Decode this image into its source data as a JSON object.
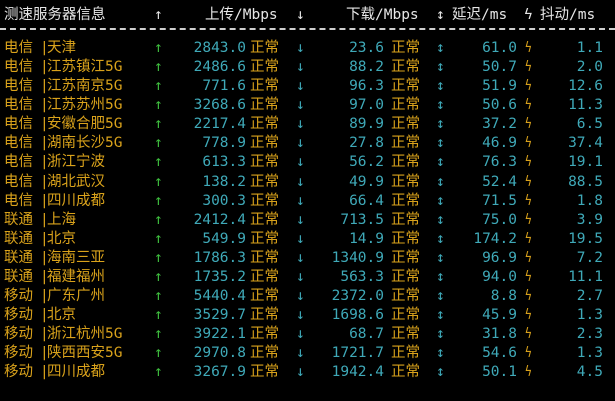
{
  "header": {
    "title": "测速服务器信息",
    "upload_arrow": "↑",
    "upload": "上传/Mbps",
    "upload_down_arrow": "↓",
    "download": "下载/Mbps",
    "updown_arrow": "↕",
    "latency": "延迟/ms",
    "bolt": "ϟ",
    "jitter": "抖动/ms"
  },
  "symbols": {
    "bar": "|",
    "up": "↑",
    "down": "↓",
    "updown": "↕",
    "bolt": "ϟ",
    "ok": "正常"
  },
  "colors": {
    "background": "#000000",
    "label": "#d9a21b",
    "value": "#3fa9b8",
    "arrow_up": "#3fbf3f",
    "header": "#e6e6e6"
  },
  "rows": [
    {
      "isp": "电信",
      "city": "天津",
      "upload": "2843.0",
      "status_up": "正常",
      "download": "23.6",
      "status_down": "正常",
      "latency": "61.0",
      "jitter": "1.1"
    },
    {
      "isp": "电信",
      "city": "江苏镇江5G",
      "upload": "2486.6",
      "status_up": "正常",
      "download": "88.2",
      "status_down": "正常",
      "latency": "50.7",
      "jitter": "2.0"
    },
    {
      "isp": "电信",
      "city": "江苏南京5G",
      "upload": "771.6",
      "status_up": "正常",
      "download": "96.3",
      "status_down": "正常",
      "latency": "51.9",
      "jitter": "12.6"
    },
    {
      "isp": "电信",
      "city": "江苏苏州5G",
      "upload": "3268.6",
      "status_up": "正常",
      "download": "97.0",
      "status_down": "正常",
      "latency": "50.6",
      "jitter": "11.3"
    },
    {
      "isp": "电信",
      "city": "安徽合肥5G",
      "upload": "2217.4",
      "status_up": "正常",
      "download": "89.9",
      "status_down": "正常",
      "latency": "37.2",
      "jitter": "6.5"
    },
    {
      "isp": "电信",
      "city": "湖南长沙5G",
      "upload": "778.9",
      "status_up": "正常",
      "download": "27.8",
      "status_down": "正常",
      "latency": "46.9",
      "jitter": "37.4"
    },
    {
      "isp": "电信",
      "city": "浙江宁波",
      "upload": "613.3",
      "status_up": "正常",
      "download": "56.2",
      "status_down": "正常",
      "latency": "76.3",
      "jitter": "19.1"
    },
    {
      "isp": "电信",
      "city": "湖北武汉",
      "upload": "138.2",
      "status_up": "正常",
      "download": "49.9",
      "status_down": "正常",
      "latency": "52.4",
      "jitter": "88.5"
    },
    {
      "isp": "电信",
      "city": "四川成都",
      "upload": "300.3",
      "status_up": "正常",
      "download": "66.4",
      "status_down": "正常",
      "latency": "71.5",
      "jitter": "1.8"
    },
    {
      "isp": "联通",
      "city": "上海",
      "upload": "2412.4",
      "status_up": "正常",
      "download": "713.5",
      "status_down": "正常",
      "latency": "75.0",
      "jitter": "3.9"
    },
    {
      "isp": "联通",
      "city": "北京",
      "upload": "549.9",
      "status_up": "正常",
      "download": "14.9",
      "status_down": "正常",
      "latency": "174.2",
      "jitter": "19.5"
    },
    {
      "isp": "联通",
      "city": "海南三亚",
      "upload": "1786.3",
      "status_up": "正常",
      "download": "1340.9",
      "status_down": "正常",
      "latency": "96.9",
      "jitter": "7.2"
    },
    {
      "isp": "联通",
      "city": "福建福州",
      "upload": "1735.2",
      "status_up": "正常",
      "download": "563.3",
      "status_down": "正常",
      "latency": "94.0",
      "jitter": "11.1"
    },
    {
      "isp": "移动",
      "city": "广东广州",
      "upload": "5440.4",
      "status_up": "正常",
      "download": "2372.0",
      "status_down": "正常",
      "latency": "8.8",
      "jitter": "2.7"
    },
    {
      "isp": "移动",
      "city": "北京",
      "upload": "3529.7",
      "status_up": "正常",
      "download": "1698.6",
      "status_down": "正常",
      "latency": "45.9",
      "jitter": "1.3"
    },
    {
      "isp": "移动",
      "city": "浙江杭州5G",
      "upload": "3922.1",
      "status_up": "正常",
      "download": "68.7",
      "status_down": "正常",
      "latency": "31.8",
      "jitter": "2.3"
    },
    {
      "isp": "移动",
      "city": "陕西西安5G",
      "upload": "2970.8",
      "status_up": "正常",
      "download": "1721.7",
      "status_down": "正常",
      "latency": "54.6",
      "jitter": "1.3"
    },
    {
      "isp": "移动",
      "city": "四川成都",
      "upload": "3267.9",
      "status_up": "正常",
      "download": "1942.4",
      "status_down": "正常",
      "latency": "50.1",
      "jitter": "4.5"
    }
  ]
}
